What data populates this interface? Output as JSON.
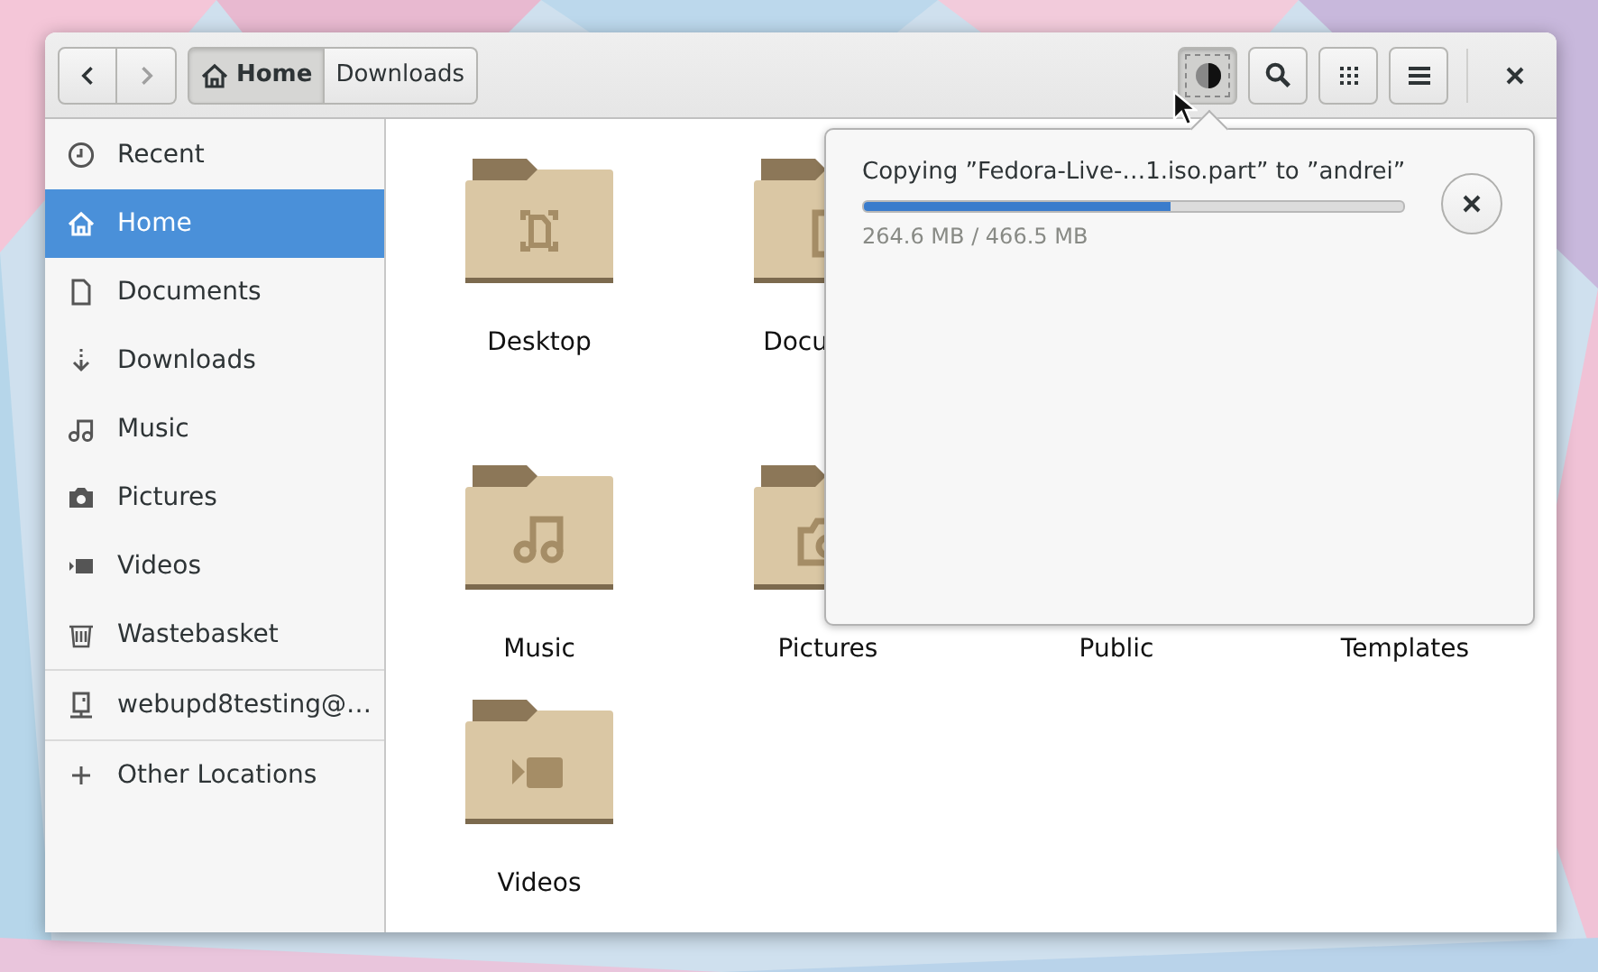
{
  "toolbar": {
    "nav": [
      {
        "kind": "back",
        "disabled": false
      },
      {
        "kind": "forward",
        "disabled": true
      }
    ],
    "path": [
      {
        "label": "Home",
        "kind": "home",
        "selected": true
      },
      {
        "label": "Downloads",
        "kind": "folder",
        "selected": false
      }
    ],
    "actions": [
      {
        "kind": "operations",
        "on": true
      },
      {
        "kind": "search",
        "on": false
      },
      {
        "kind": "view",
        "on": false
      },
      {
        "kind": "menu",
        "on": false
      }
    ]
  },
  "sidebar": {
    "groups": [
      {
        "items": [
          {
            "label": "Recent",
            "kind": "recent",
            "selected": false
          },
          {
            "label": "Home",
            "kind": "home",
            "selected": true
          },
          {
            "label": "Documents",
            "kind": "document",
            "selected": false
          },
          {
            "label": "Downloads",
            "kind": "download",
            "selected": false
          },
          {
            "label": "Music",
            "kind": "music",
            "selected": false
          },
          {
            "label": "Pictures",
            "kind": "camera",
            "selected": false
          },
          {
            "label": "Videos",
            "kind": "video",
            "selected": false
          },
          {
            "label": "Wastebasket",
            "kind": "trash",
            "selected": false
          }
        ]
      },
      {
        "items": [
          {
            "label": "webupd8testing@…",
            "kind": "computer",
            "selected": false
          }
        ]
      },
      {
        "items": [
          {
            "label": "Other Locations",
            "kind": "plus",
            "selected": false
          }
        ]
      }
    ]
  },
  "files": {
    "rows": [
      [
        {
          "label": "Desktop",
          "kind": "desktop"
        },
        {
          "label": "Docu",
          "kind": "document"
        }
      ],
      [
        {
          "label": "Music",
          "kind": "music"
        },
        {
          "label": "Pictures",
          "kind": "camera"
        },
        {
          "label": "Public",
          "kind": "covered"
        },
        {
          "label": "Templates",
          "kind": "covered"
        }
      ],
      [
        {
          "label": "Videos",
          "kind": "video"
        }
      ]
    ]
  },
  "operation": {
    "text": "Copying ”Fedora-Live-…1.iso.part” to ”andrei”",
    "level": 0.567,
    "status": "264.6 MB / 466.5 MB"
  }
}
